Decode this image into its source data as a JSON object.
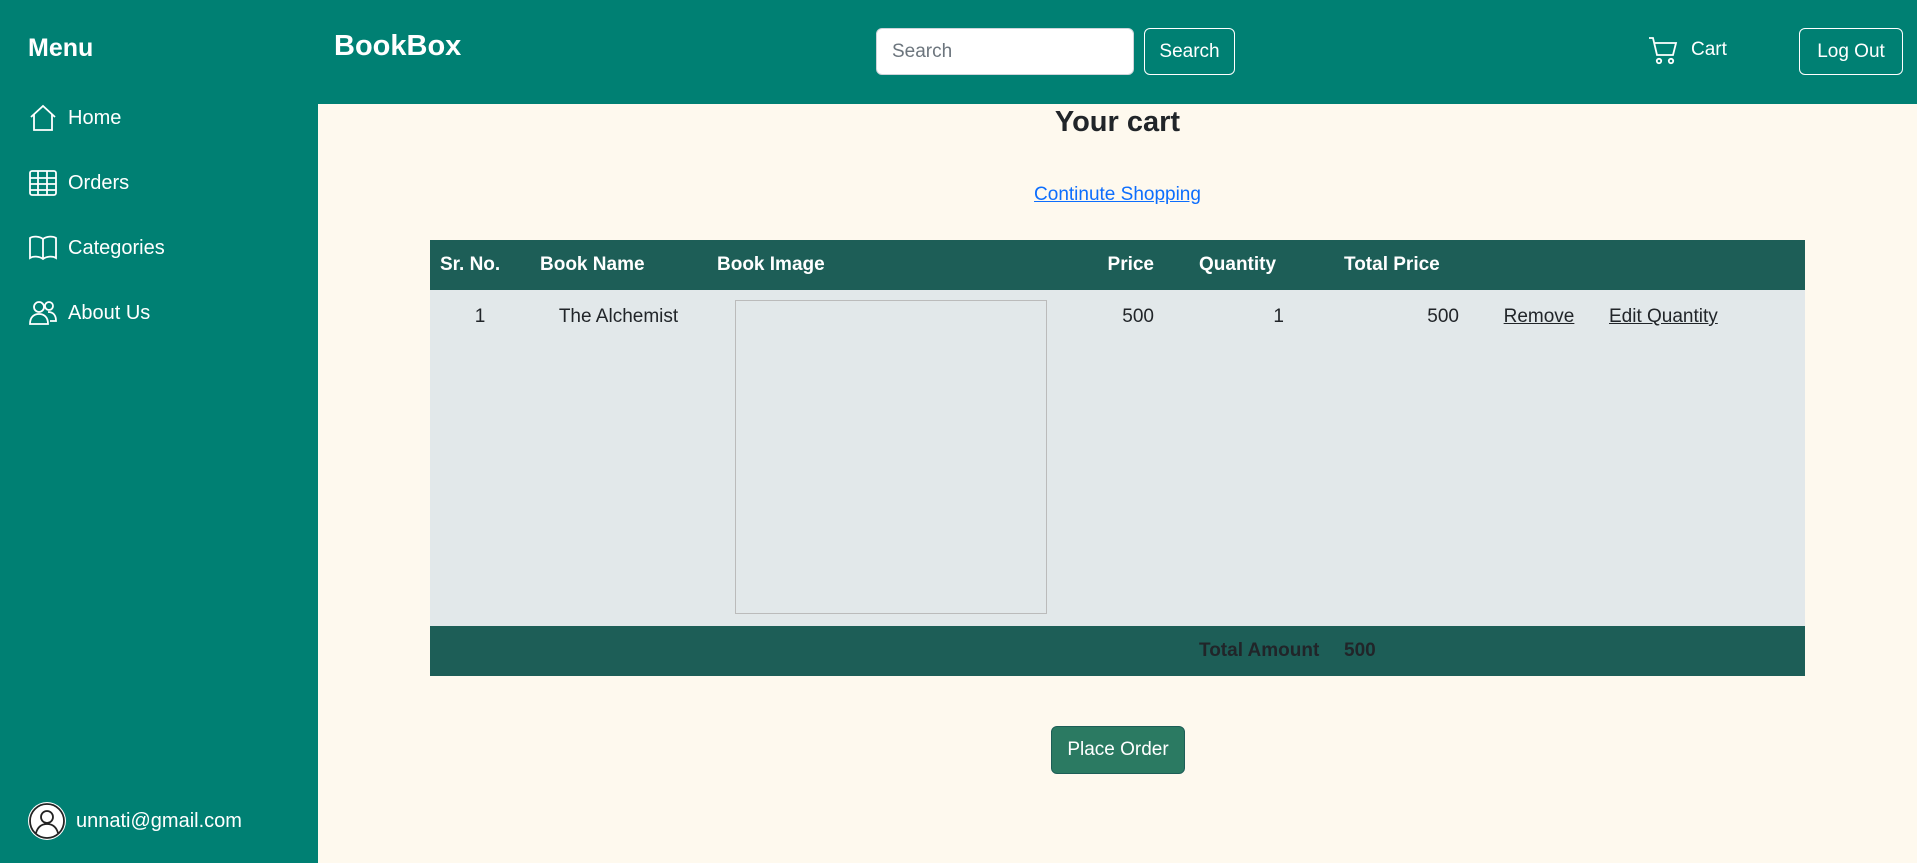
{
  "sidebar": {
    "title": "Menu",
    "items": [
      {
        "label": "Home",
        "icon": "home-icon"
      },
      {
        "label": "Orders",
        "icon": "table-icon"
      },
      {
        "label": "Categories",
        "icon": "book-icon"
      },
      {
        "label": "About Us",
        "icon": "people-icon"
      }
    ],
    "user_email": "unnati@gmail.com"
  },
  "header": {
    "brand": "BookBox",
    "search_placeholder": "Search",
    "search_button": "Search",
    "cart_label": "Cart",
    "logout_label": "Log Out"
  },
  "main": {
    "title": "Your cart",
    "continue_shopping": "Continute Shopping",
    "table": {
      "headers": [
        "Sr. No.",
        "Book Name",
        "Book Image",
        "Price",
        "Quantity",
        "Total Price"
      ],
      "rows": [
        {
          "sr": "1",
          "name": "The Alchemist",
          "price": "500",
          "quantity": "1",
          "total": "500",
          "remove": "Remove",
          "edit": "Edit Quantity"
        }
      ],
      "footer_label": "Total Amount",
      "footer_total": "500"
    },
    "place_order": "Place Order"
  },
  "colors": {
    "primary": "#008073",
    "table_header": "#1d5e57",
    "background": "#fef9ee",
    "button": "#2b7a62"
  }
}
